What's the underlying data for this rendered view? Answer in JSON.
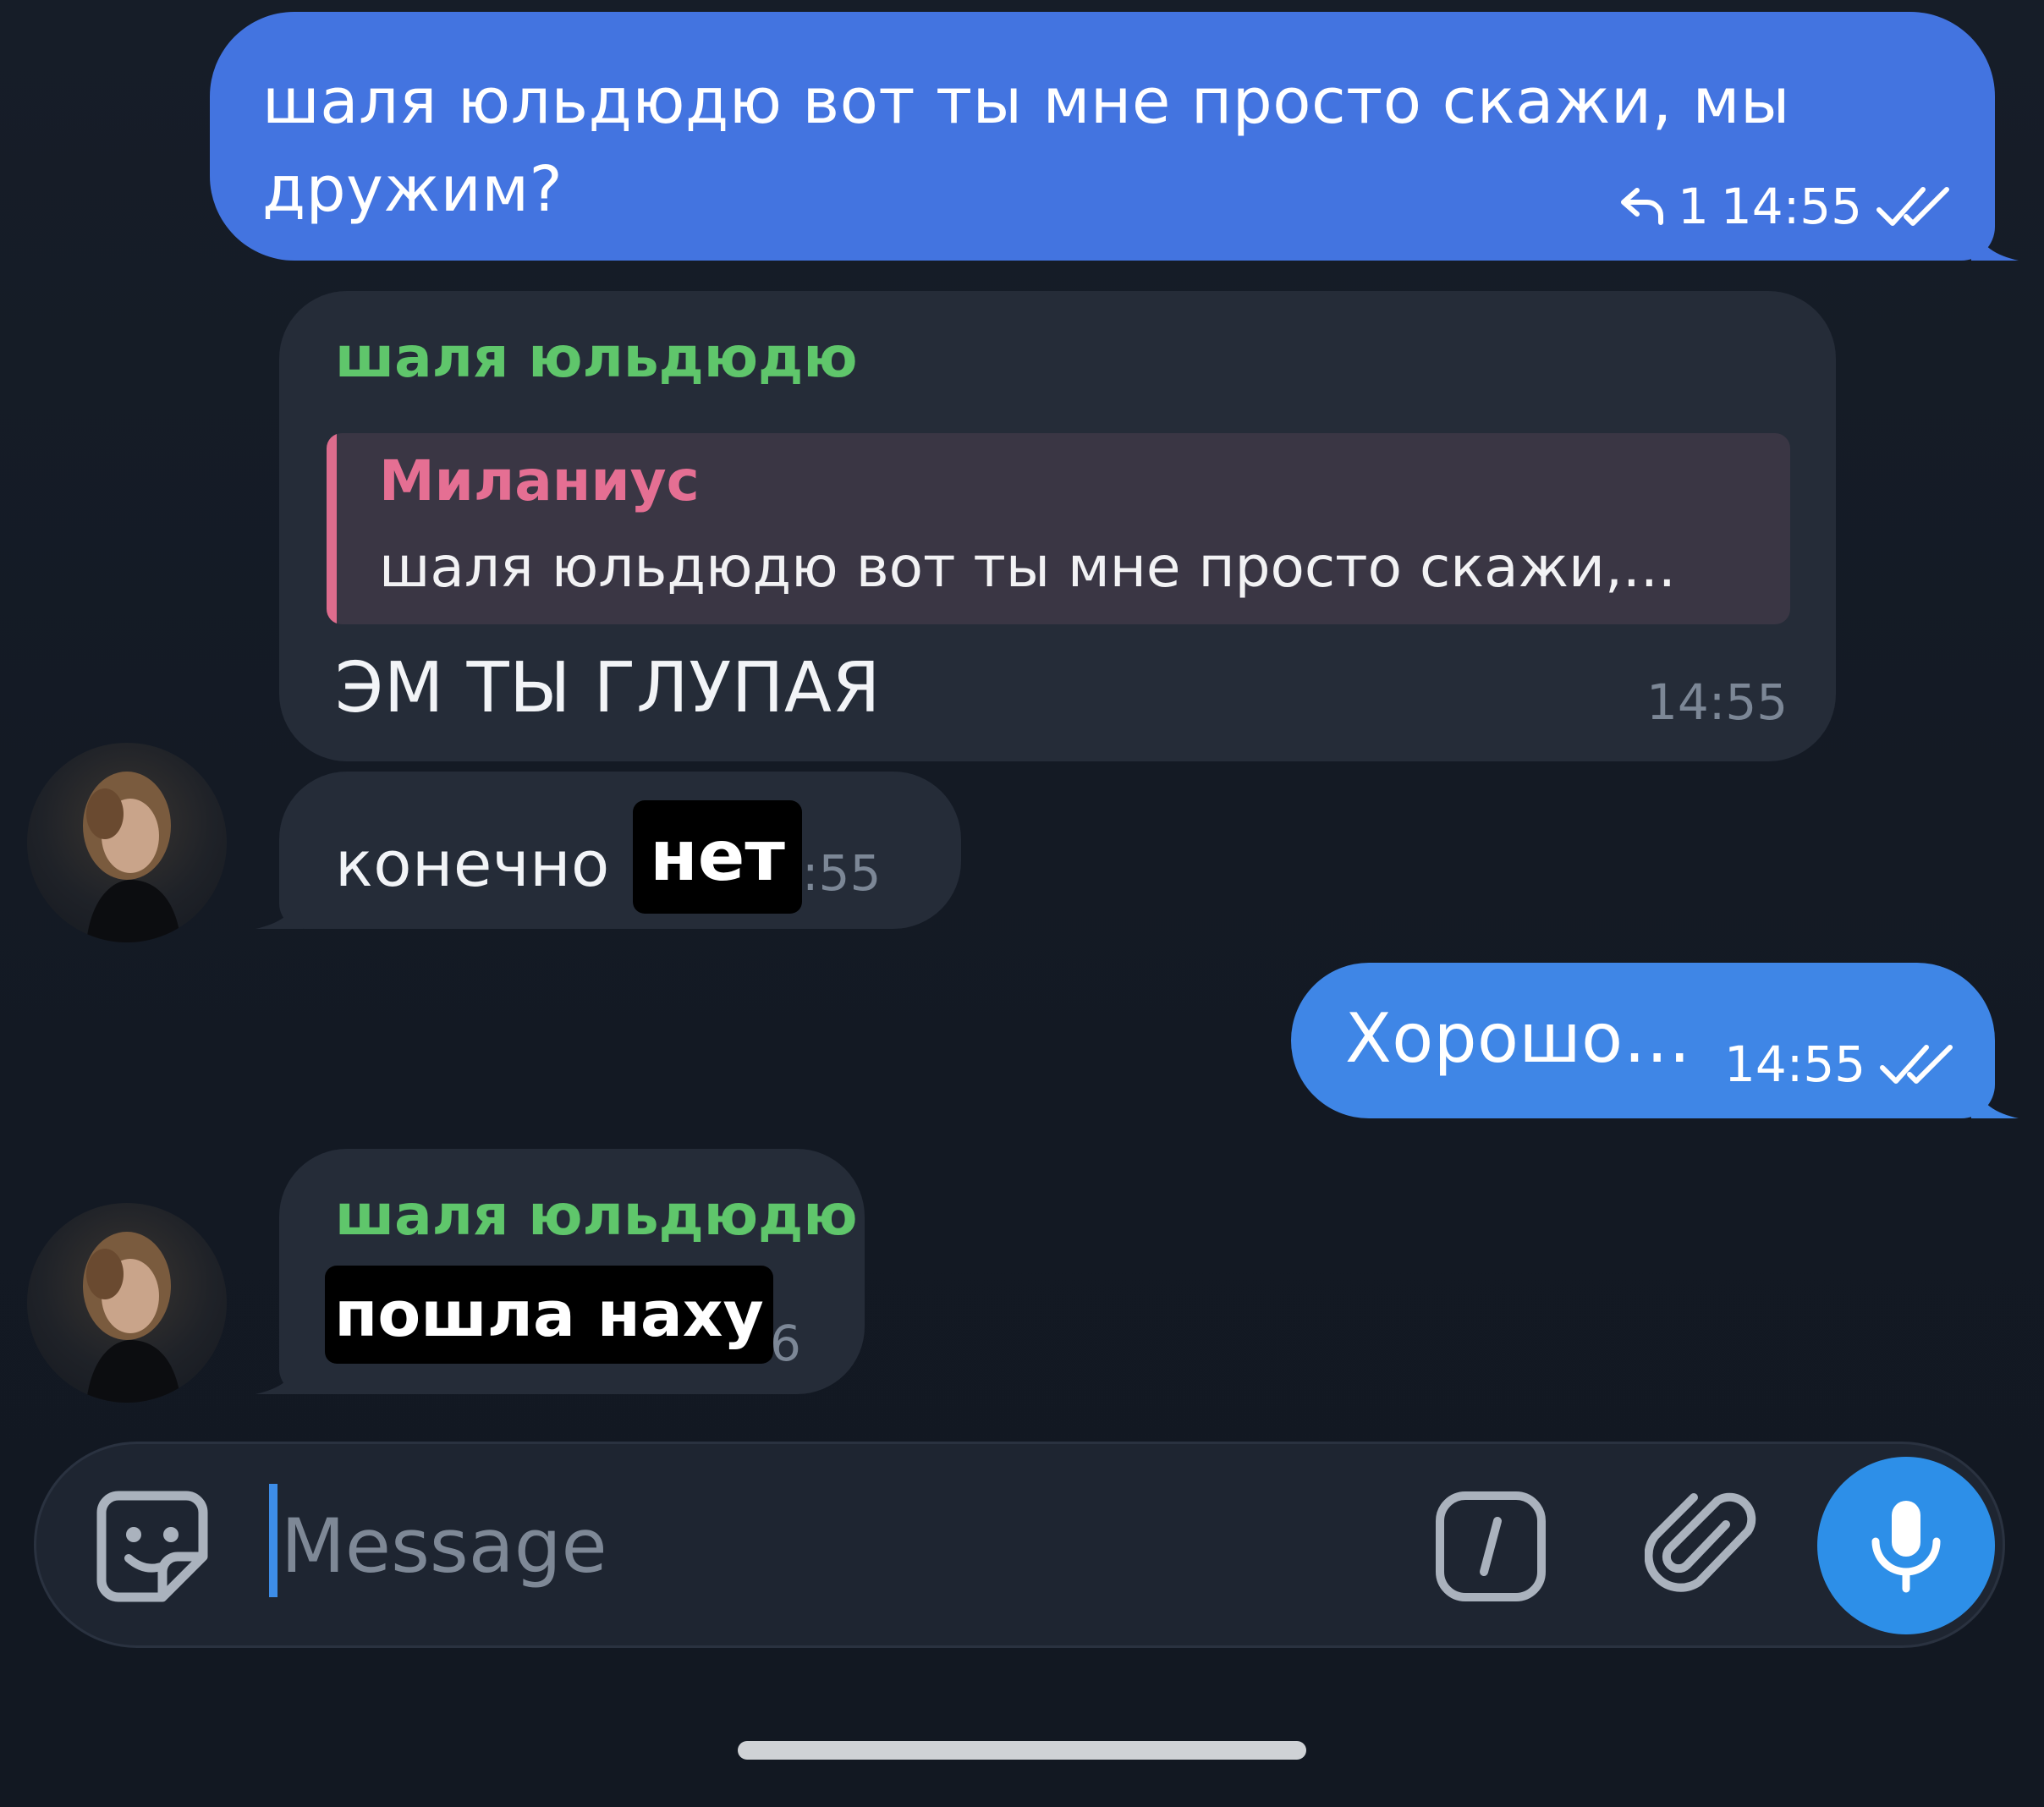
{
  "messages": [
    {
      "direction": "outgoing",
      "text": "шаля юльдюдю вот ты мне просто скажи, мы дружим?",
      "reply_count": "1",
      "time": "14:55"
    },
    {
      "direction": "incoming",
      "sender": "шаля юльдюдю",
      "reply_to": {
        "name": "Миланиус",
        "text": "шаля юльдюдю вот ты мне просто скажи,..."
      },
      "text": "ЭМ ТЫ ГЛУПАЯ",
      "time": "14:55"
    },
    {
      "direction": "incoming",
      "text": "конечно",
      "sticker": "нет",
      "time_partial": ":55"
    },
    {
      "direction": "outgoing",
      "text": "Хорошо…",
      "time": "14:55"
    },
    {
      "direction": "incoming",
      "sender": "шаля юльдюдю",
      "sticker": "пошла наху",
      "time_partial": "6"
    }
  ],
  "composer": {
    "placeholder": "Message"
  },
  "icons": {
    "sticker": "sticker-icon",
    "commands": "slash-command-icon",
    "attach": "paperclip-icon",
    "mic": "microphone-icon",
    "reply": "reply-arrow-icon",
    "read": "double-check-icon"
  },
  "colors": {
    "outgoing_bubble": "#4374e0",
    "incoming_bubble": "#252c38",
    "sender_name": "#5fc66b",
    "reply_name": "#e56f93",
    "mic_button": "#2d8fe8"
  }
}
